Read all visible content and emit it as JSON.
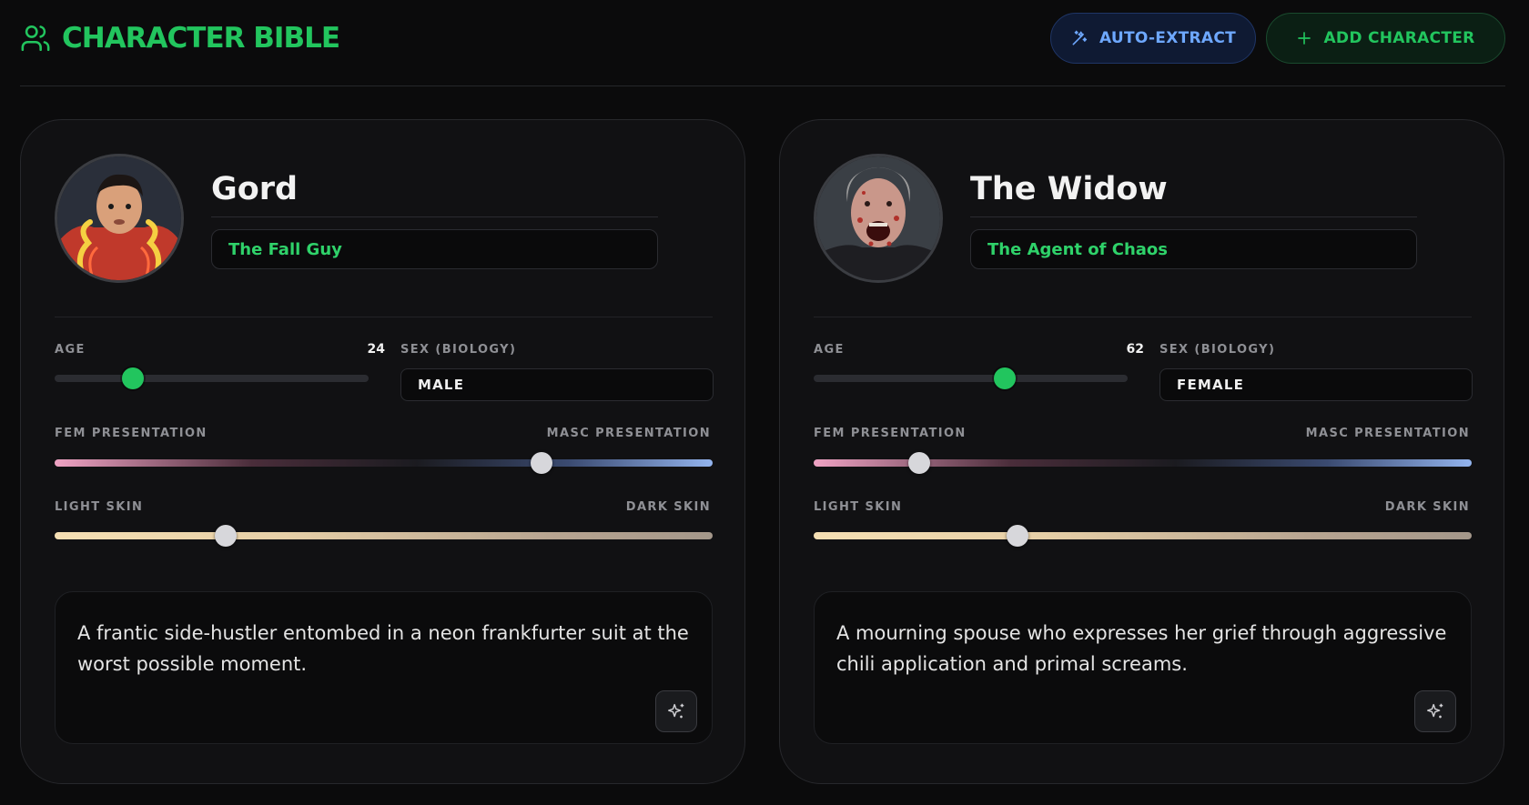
{
  "header": {
    "title": "CHARACTER BIBLE",
    "auto_extract_label": "AUTO-EXTRACT",
    "add_character_label": "ADD CHARACTER"
  },
  "colors": {
    "accent_green": "#22c55e",
    "accent_blue": "#6ea8ff",
    "background": "#0b0b0c",
    "card": "#111113"
  },
  "labels": {
    "age": "AGE",
    "sex": "SEX (BIOLOGY)",
    "fem": "FEM PRESENTATION",
    "masc": "MASC PRESENTATION",
    "light_skin": "LIGHT SKIN",
    "dark_skin": "DARK SKIN"
  },
  "characters": [
    {
      "name": "Gord",
      "role": "The Fall Guy",
      "age": "24",
      "age_fraction": 0.25,
      "sex": "MALE",
      "presentation_fraction": 0.74,
      "skin_fraction": 0.26,
      "description": "A frantic side-hustler entombed in a neon frankfurter suit at the worst possible moment.",
      "avatar_icon": "young-man-portrait-icon"
    },
    {
      "name": "The Widow",
      "role": "The Agent of Chaos",
      "age": "62",
      "age_fraction": 0.61,
      "sex": "FEMALE",
      "presentation_fraction": 0.16,
      "skin_fraction": 0.31,
      "description": "A mourning spouse who expresses her grief through aggressive chili application and primal screams.",
      "avatar_icon": "screaming-woman-portrait-icon"
    }
  ]
}
